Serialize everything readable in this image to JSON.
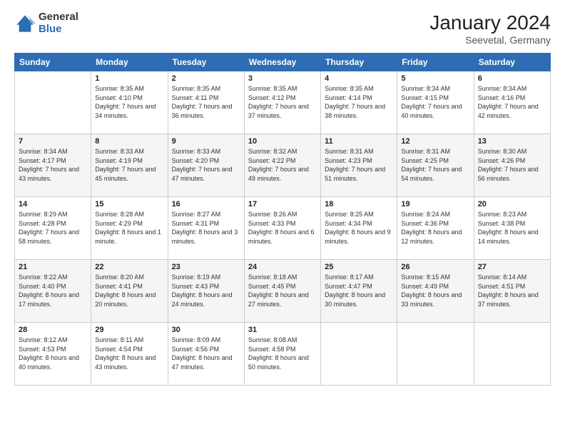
{
  "logo": {
    "general": "General",
    "blue": "Blue"
  },
  "header": {
    "title": "January 2024",
    "subtitle": "Seevetal, Germany"
  },
  "weekdays": [
    "Sunday",
    "Monday",
    "Tuesday",
    "Wednesday",
    "Thursday",
    "Friday",
    "Saturday"
  ],
  "weeks": [
    [
      {
        "day": "",
        "sunrise": "",
        "sunset": "",
        "daylight": ""
      },
      {
        "day": "1",
        "sunrise": "Sunrise: 8:35 AM",
        "sunset": "Sunset: 4:10 PM",
        "daylight": "Daylight: 7 hours and 34 minutes."
      },
      {
        "day": "2",
        "sunrise": "Sunrise: 8:35 AM",
        "sunset": "Sunset: 4:11 PM",
        "daylight": "Daylight: 7 hours and 36 minutes."
      },
      {
        "day": "3",
        "sunrise": "Sunrise: 8:35 AM",
        "sunset": "Sunset: 4:12 PM",
        "daylight": "Daylight: 7 hours and 37 minutes."
      },
      {
        "day": "4",
        "sunrise": "Sunrise: 8:35 AM",
        "sunset": "Sunset: 4:14 PM",
        "daylight": "Daylight: 7 hours and 38 minutes."
      },
      {
        "day": "5",
        "sunrise": "Sunrise: 8:34 AM",
        "sunset": "Sunset: 4:15 PM",
        "daylight": "Daylight: 7 hours and 40 minutes."
      },
      {
        "day": "6",
        "sunrise": "Sunrise: 8:34 AM",
        "sunset": "Sunset: 4:16 PM",
        "daylight": "Daylight: 7 hours and 42 minutes."
      }
    ],
    [
      {
        "day": "7",
        "sunrise": "Sunrise: 8:34 AM",
        "sunset": "Sunset: 4:17 PM",
        "daylight": "Daylight: 7 hours and 43 minutes."
      },
      {
        "day": "8",
        "sunrise": "Sunrise: 8:33 AM",
        "sunset": "Sunset: 4:19 PM",
        "daylight": "Daylight: 7 hours and 45 minutes."
      },
      {
        "day": "9",
        "sunrise": "Sunrise: 8:33 AM",
        "sunset": "Sunset: 4:20 PM",
        "daylight": "Daylight: 7 hours and 47 minutes."
      },
      {
        "day": "10",
        "sunrise": "Sunrise: 8:32 AM",
        "sunset": "Sunset: 4:22 PM",
        "daylight": "Daylight: 7 hours and 49 minutes."
      },
      {
        "day": "11",
        "sunrise": "Sunrise: 8:31 AM",
        "sunset": "Sunset: 4:23 PM",
        "daylight": "Daylight: 7 hours and 51 minutes."
      },
      {
        "day": "12",
        "sunrise": "Sunrise: 8:31 AM",
        "sunset": "Sunset: 4:25 PM",
        "daylight": "Daylight: 7 hours and 54 minutes."
      },
      {
        "day": "13",
        "sunrise": "Sunrise: 8:30 AM",
        "sunset": "Sunset: 4:26 PM",
        "daylight": "Daylight: 7 hours and 56 minutes."
      }
    ],
    [
      {
        "day": "14",
        "sunrise": "Sunrise: 8:29 AM",
        "sunset": "Sunset: 4:28 PM",
        "daylight": "Daylight: 7 hours and 58 minutes."
      },
      {
        "day": "15",
        "sunrise": "Sunrise: 8:28 AM",
        "sunset": "Sunset: 4:29 PM",
        "daylight": "Daylight: 8 hours and 1 minute."
      },
      {
        "day": "16",
        "sunrise": "Sunrise: 8:27 AM",
        "sunset": "Sunset: 4:31 PM",
        "daylight": "Daylight: 8 hours and 3 minutes."
      },
      {
        "day": "17",
        "sunrise": "Sunrise: 8:26 AM",
        "sunset": "Sunset: 4:33 PM",
        "daylight": "Daylight: 8 hours and 6 minutes."
      },
      {
        "day": "18",
        "sunrise": "Sunrise: 8:25 AM",
        "sunset": "Sunset: 4:34 PM",
        "daylight": "Daylight: 8 hours and 9 minutes."
      },
      {
        "day": "19",
        "sunrise": "Sunrise: 8:24 AM",
        "sunset": "Sunset: 4:36 PM",
        "daylight": "Daylight: 8 hours and 12 minutes."
      },
      {
        "day": "20",
        "sunrise": "Sunrise: 8:23 AM",
        "sunset": "Sunset: 4:38 PM",
        "daylight": "Daylight: 8 hours and 14 minutes."
      }
    ],
    [
      {
        "day": "21",
        "sunrise": "Sunrise: 8:22 AM",
        "sunset": "Sunset: 4:40 PM",
        "daylight": "Daylight: 8 hours and 17 minutes."
      },
      {
        "day": "22",
        "sunrise": "Sunrise: 8:20 AM",
        "sunset": "Sunset: 4:41 PM",
        "daylight": "Daylight: 8 hours and 20 minutes."
      },
      {
        "day": "23",
        "sunrise": "Sunrise: 8:19 AM",
        "sunset": "Sunset: 4:43 PM",
        "daylight": "Daylight: 8 hours and 24 minutes."
      },
      {
        "day": "24",
        "sunrise": "Sunrise: 8:18 AM",
        "sunset": "Sunset: 4:45 PM",
        "daylight": "Daylight: 8 hours and 27 minutes."
      },
      {
        "day": "25",
        "sunrise": "Sunrise: 8:17 AM",
        "sunset": "Sunset: 4:47 PM",
        "daylight": "Daylight: 8 hours and 30 minutes."
      },
      {
        "day": "26",
        "sunrise": "Sunrise: 8:15 AM",
        "sunset": "Sunset: 4:49 PM",
        "daylight": "Daylight: 8 hours and 33 minutes."
      },
      {
        "day": "27",
        "sunrise": "Sunrise: 8:14 AM",
        "sunset": "Sunset: 4:51 PM",
        "daylight": "Daylight: 8 hours and 37 minutes."
      }
    ],
    [
      {
        "day": "28",
        "sunrise": "Sunrise: 8:12 AM",
        "sunset": "Sunset: 4:53 PM",
        "daylight": "Daylight: 8 hours and 40 minutes."
      },
      {
        "day": "29",
        "sunrise": "Sunrise: 8:11 AM",
        "sunset": "Sunset: 4:54 PM",
        "daylight": "Daylight: 8 hours and 43 minutes."
      },
      {
        "day": "30",
        "sunrise": "Sunrise: 8:09 AM",
        "sunset": "Sunset: 4:56 PM",
        "daylight": "Daylight: 8 hours and 47 minutes."
      },
      {
        "day": "31",
        "sunrise": "Sunrise: 8:08 AM",
        "sunset": "Sunset: 4:58 PM",
        "daylight": "Daylight: 8 hours and 50 minutes."
      },
      {
        "day": "",
        "sunrise": "",
        "sunset": "",
        "daylight": ""
      },
      {
        "day": "",
        "sunrise": "",
        "sunset": "",
        "daylight": ""
      },
      {
        "day": "",
        "sunrise": "",
        "sunset": "",
        "daylight": ""
      }
    ]
  ]
}
